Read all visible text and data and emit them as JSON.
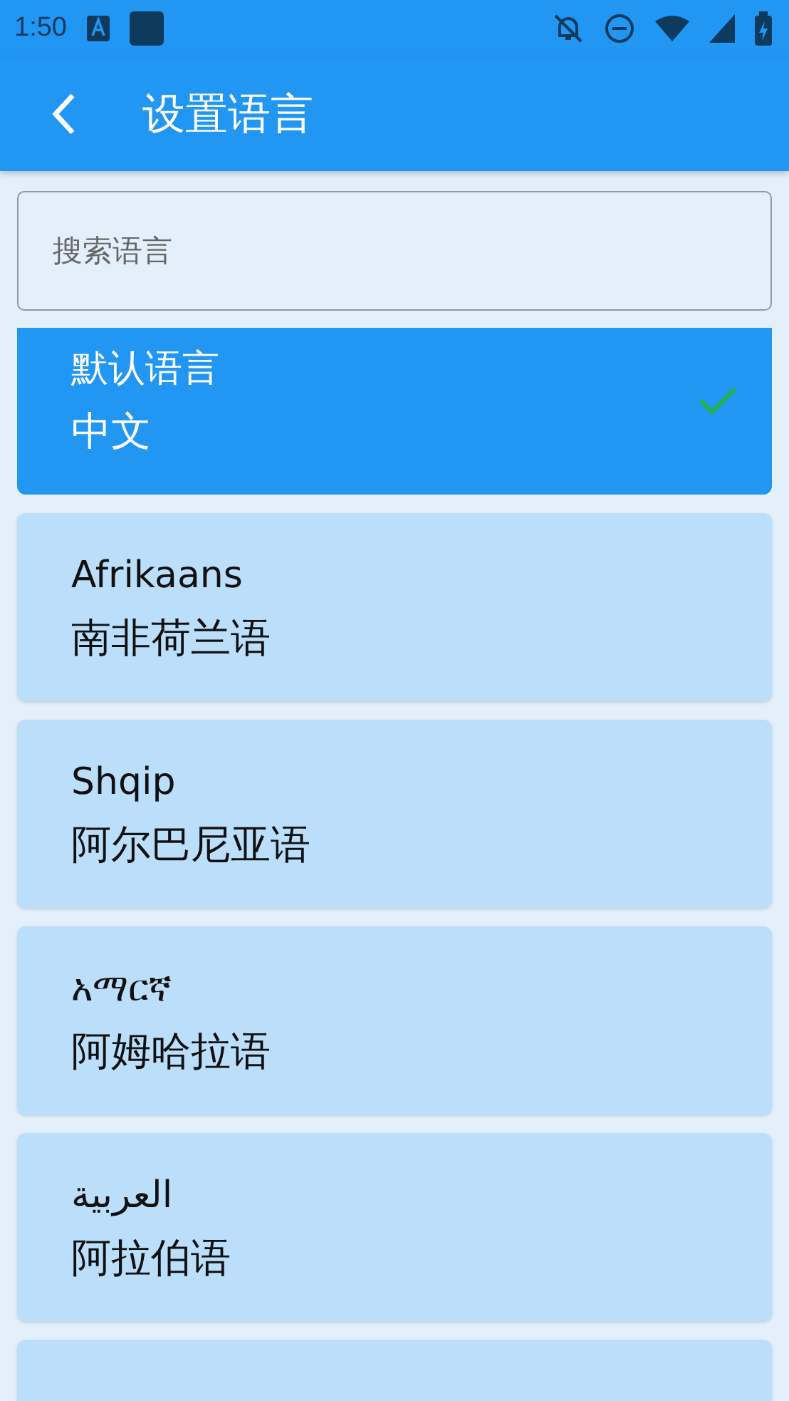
{
  "status_bar": {
    "time": "1:50"
  },
  "app_bar": {
    "title": "设置语言"
  },
  "search": {
    "placeholder": "搜索语言"
  },
  "languages": [
    {
      "native": "默认语言",
      "name": "中文",
      "selected": true
    },
    {
      "native": "Afrikaans",
      "name": "南非荷兰语",
      "selected": false
    },
    {
      "native": "Shqip",
      "name": "阿尔巴尼亚语",
      "selected": false
    },
    {
      "native": "አማርኛ",
      "name": "阿姆哈拉语",
      "selected": false
    },
    {
      "native": "العربية",
      "name": "阿拉伯语",
      "selected": false
    },
    {
      "selected": false
    }
  ]
}
